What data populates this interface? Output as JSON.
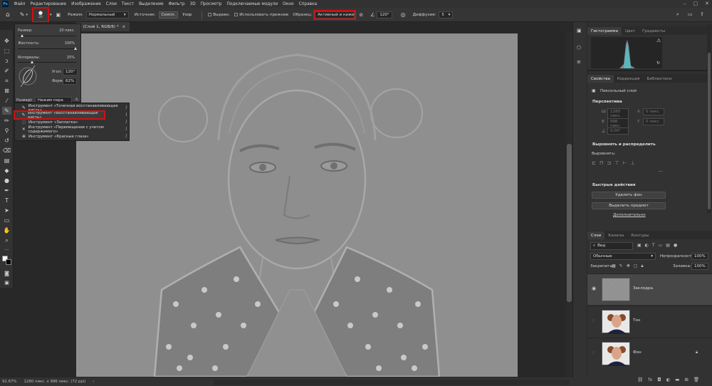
{
  "menu": [
    "Файл",
    "Редактирование",
    "Изображение",
    "Слои",
    "Текст",
    "Выделение",
    "Фильтр",
    "3D",
    "Просмотр",
    "Подключаемые модули",
    "Окно",
    "Справка"
  ],
  "options": {
    "brush_size": "20",
    "mode_label": "Режим:",
    "mode_value": "Нормальный",
    "source_label": "Источник:",
    "source_btn1": "Семпл.",
    "source_btn2": "Узор",
    "align_label": "Выравн.",
    "use_legacy_label": "Использовать прежние",
    "sample_label": "Образец:",
    "sample_value": "Активный и ниже",
    "angle_value": "120°",
    "diffusion_label": "Диффузия:",
    "diffusion_value": "5"
  },
  "doc_tab": {
    "title": "; (Слой 1, RGB/8) *",
    "close": "×"
  },
  "brush_popup": {
    "size_label": "Размер:",
    "size_value": "20 пикс.",
    "hardness_label": "Жесткость:",
    "hardness_value": "100%",
    "spacing_label": "Интервалы:",
    "spacing_value": "25%",
    "angle_label": "Угол:",
    "angle_value": "120°",
    "roundness_label": "Форма:",
    "roundness_value": "62%",
    "size_ctrl_label": "Размер",
    "size_ctrl_value": "Нажим пера"
  },
  "flyout": [
    {
      "label": "Инструмент «Точечная восстанавливающая кисть»",
      "key": "J",
      "icon": "spot-healing-brush-icon"
    },
    {
      "label": "Инструмент «Восстанавливающая кисть»",
      "key": "J",
      "icon": "healing-brush-icon"
    },
    {
      "label": "Инструмент «Заплатка»",
      "key": "J",
      "icon": "patch-icon"
    },
    {
      "label": "Инструмент «Перемещение с учетом содержимого»",
      "key": "J",
      "icon": "content-aware-move-icon"
    },
    {
      "label": "Инструмент «Красные глаза»",
      "key": "J",
      "icon": "red-eye-icon"
    }
  ],
  "status": {
    "zoom": "92,67%",
    "size": "1280 пикс. x 996 пикс. (72 ppi)"
  },
  "histogram": {
    "tabs": [
      "Гистограмма",
      "Цвет",
      "Градиенты"
    ]
  },
  "properties": {
    "tabs": [
      "Свойства",
      "Коррекция",
      "Библиотеки"
    ],
    "layer_type": "Пиксельный слой",
    "perspective": "Перспектива",
    "w_label": "Ш",
    "w_value": "1280 пикс.",
    "x_label": "X",
    "x_value": "0 пикс.",
    "h_label": "В",
    "h_value": "996 пикс.",
    "y_label": "Y",
    "y_value": "0 пикс.",
    "angle_value": "0,00°",
    "align_section": "Выровнять и распределить",
    "align_label": "Выровнять:",
    "quick_actions": "Быстрые действия",
    "remove_bg": "Удалить фон",
    "select_subject": "Выделить предмет",
    "more": "Дополнительно"
  },
  "layers": {
    "tabs": [
      "Слои",
      "Каналы",
      "Контуры"
    ],
    "filter_value": "Вид",
    "blend_value": "Обычные",
    "opacity_label": "Непрозрачность:",
    "opacity_value": "100%",
    "lock_label": "Закрепить:",
    "fill_label": "Заливка:",
    "fill_value": "100%",
    "items": [
      {
        "name": "Заклодра."
      },
      {
        "name": "Тон"
      },
      {
        "name": "Фон"
      }
    ]
  },
  "colors": {
    "highlight": "#d01010",
    "canvas": "#8f8f8f"
  }
}
